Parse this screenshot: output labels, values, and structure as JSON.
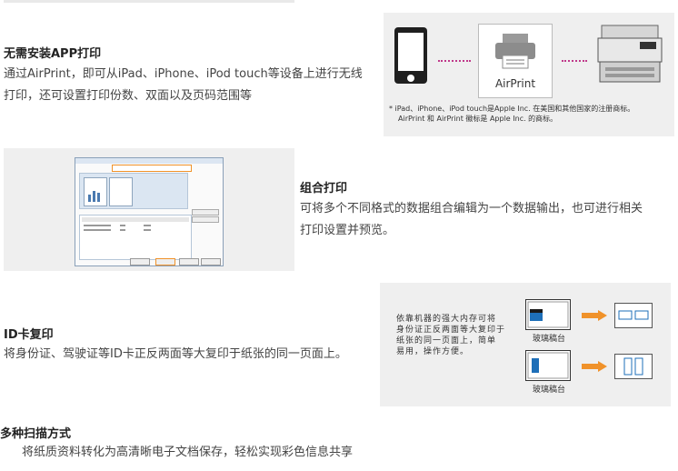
{
  "sections": {
    "airprint": {
      "title": "无需安装APP打印",
      "desc_line1": "通过AirPrint，即可从iPad、iPhone、iPod touch等设备上进行无线",
      "desc_line2": "打印，还可设置打印份数、双面以及页码范围等",
      "figure": {
        "label": "AirPrint",
        "note_line1": "* iPad、iPhone、iPod touch是Apple Inc. 在美国和其他国家的注册商标。",
        "note_line2": "AirPrint 和 AirPrint 徽标是 Apple Inc. 的商标。"
      }
    },
    "combine": {
      "title": "组合打印",
      "desc_line1": "可将多个不同格式的数据组合编辑为一个数据输出，也可进行相关",
      "desc_line2": "打印设置并预览。"
    },
    "idcopy": {
      "title": "ID卡复印",
      "desc": "将身份证、驾驶证等ID卡正反两面等大复印于纸张的同一页面上。",
      "figure": {
        "text_line1": "依靠机器的强大内存可将",
        "text_line2": "身份证正反两面等大复印于",
        "text_line3": "纸张的同一页面上，简单",
        "text_line4": "易用，操作方便。",
        "glass_label_1": "玻璃稿台",
        "glass_label_2": "玻璃稿台"
      }
    },
    "scan": {
      "title": "多种扫描方式",
      "desc": "将纸质资料转化为高清晰电子文档保存，轻松实现彩色信息共享"
    }
  },
  "colors": {
    "accent_orange": "#f0922a",
    "dots_magenta": "#c0398a",
    "blue": "#1e6fb8",
    "panel_bg": "#efefef"
  }
}
